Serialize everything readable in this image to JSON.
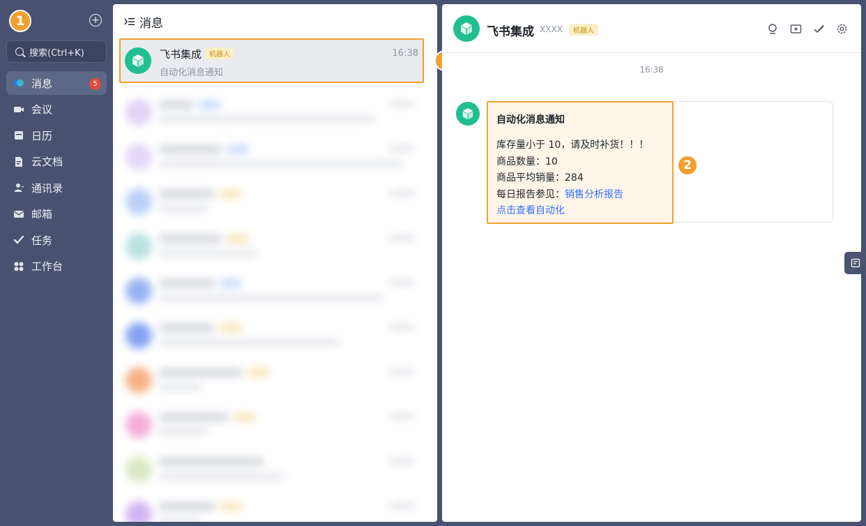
{
  "sidebar": {
    "badge_number": "1",
    "search_placeholder": "搜索(Ctrl+K)",
    "items": [
      {
        "label": "消息",
        "icon": "message-icon",
        "badge": "5"
      },
      {
        "label": "会议",
        "icon": "video-icon"
      },
      {
        "label": "日历",
        "icon": "calendar-icon"
      },
      {
        "label": "云文档",
        "icon": "doc-icon"
      },
      {
        "label": "通讯录",
        "icon": "contacts-icon"
      },
      {
        "label": "邮箱",
        "icon": "mail-icon"
      },
      {
        "label": "任务",
        "icon": "task-icon"
      },
      {
        "label": "工作台",
        "icon": "workplace-icon"
      }
    ]
  },
  "list": {
    "title": "消息",
    "active_chat": {
      "name": "飞书集成",
      "tag": "机器人",
      "time": "16:38",
      "preview": "自动化消息通知"
    }
  },
  "chat": {
    "title": "飞书集成",
    "subtitle": "XXXX",
    "tag": "机器人",
    "message_time": "16:38",
    "card": {
      "title": "自动化消息通知",
      "line1": "库存量小于 10，请及时补货！！！",
      "line2": "商品数量：10",
      "line3": "商品平均销量：284",
      "line4_prefix": "每日报告参见：",
      "line4_link": "销售分析报告",
      "line5_link": "点击查看自动化"
    }
  },
  "annotations": {
    "step1": "1",
    "step2": "2"
  },
  "colors": {
    "sidebar_bg": "#485270",
    "highlight": "#f0a030",
    "avatar": "#1fbf8f",
    "link": "#3370ff",
    "badge_red": "#e04a3f"
  }
}
